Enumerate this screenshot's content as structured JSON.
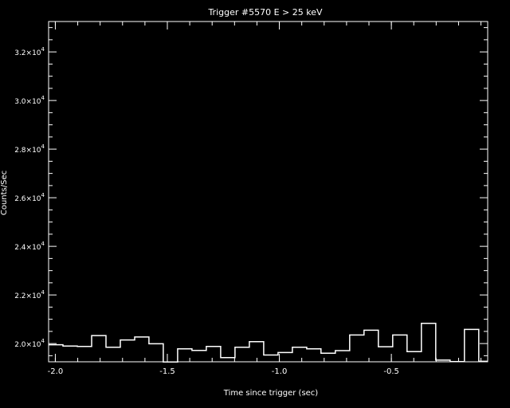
{
  "chart_data": {
    "type": "line",
    "style": "histogram-step",
    "title": "Trigger #5570 E > 25 keV",
    "xlabel": "Time since trigger (sec)",
    "ylabel": "Counts/Sec",
    "xlim": [
      -2.03,
      -0.07
    ],
    "ylim": [
      19250,
      33250
    ],
    "x_ticks": [
      {
        "value": -2.0,
        "label": "-2.0"
      },
      {
        "value": -1.5,
        "label": "-1.5"
      },
      {
        "value": -1.0,
        "label": "-1.0"
      },
      {
        "value": -0.5,
        "label": "-0.5"
      }
    ],
    "y_ticks": [
      {
        "value": 20000,
        "mant": "2.0",
        "exp": "4"
      },
      {
        "value": 22000,
        "mant": "2.2",
        "exp": "4"
      },
      {
        "value": 24000,
        "mant": "2.4",
        "exp": "4"
      },
      {
        "value": 26000,
        "mant": "2.6",
        "exp": "4"
      },
      {
        "value": 28000,
        "mant": "2.8",
        "exp": "4"
      },
      {
        "value": 30000,
        "mant": "3.0",
        "exp": "4"
      },
      {
        "value": 32000,
        "mant": "3.2",
        "exp": "4"
      }
    ],
    "bin_width": 0.064,
    "bin_start": -2.03,
    "values": [
      19950,
      19900,
      19880,
      20330,
      19850,
      20150,
      20270,
      19990,
      19240,
      19780,
      19720,
      19880,
      19420,
      19850,
      20080,
      19530,
      19630,
      19850,
      19780,
      19600,
      19710,
      20350,
      20550,
      19870,
      20350,
      19670,
      20830,
      19320,
      19260,
      20580,
      19270
    ]
  }
}
